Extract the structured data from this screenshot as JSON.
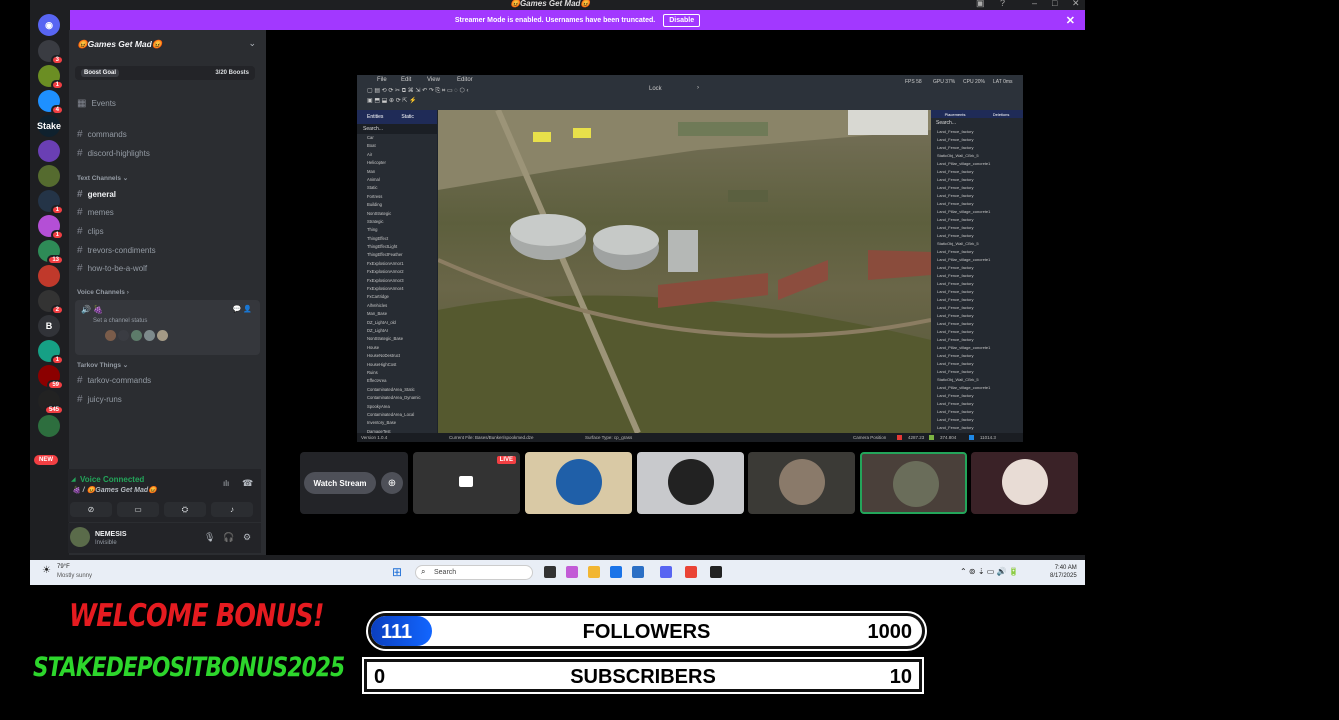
{
  "titlebar": {
    "title": "😡Games Get Mad😡"
  },
  "banner": {
    "text": "Streamer Mode is enabled. Usernames have been truncated.",
    "button": "Disable"
  },
  "servers": [
    {
      "label": "",
      "badge": "3",
      "color": "#3a3c42"
    },
    {
      "label": "",
      "badge": "1",
      "color": "#6b8e23"
    },
    {
      "label": "",
      "badge": "4",
      "color": "#1e90ff"
    },
    {
      "label": "Stake",
      "badge": "",
      "color": "#0f212e"
    },
    {
      "label": "",
      "badge": "",
      "color": "#6a3fb4"
    },
    {
      "label": "",
      "badge": "",
      "color": "#556b2f"
    },
    {
      "label": "",
      "badge": "1",
      "color": "#243447"
    },
    {
      "label": "",
      "badge": "1",
      "color": "#b44fd6"
    },
    {
      "label": "",
      "badge": "13",
      "color": "#2e8b57"
    },
    {
      "label": "",
      "badge": "",
      "color": "#c0392b"
    },
    {
      "label": "",
      "badge": "2",
      "color": "#333"
    },
    {
      "label": "B",
      "badge": "",
      "color": "#313338"
    },
    {
      "label": "",
      "badge": "1",
      "color": "#16a085"
    },
    {
      "label": "",
      "badge": "59",
      "color": "#8b0000"
    },
    {
      "label": "",
      "badge": "545",
      "color": "#222"
    },
    {
      "label": "",
      "badge": "",
      "color": "#2d6e3e"
    }
  ],
  "new_badge": "NEW",
  "sidebar": {
    "guild": "😡Games Get Mad😡",
    "boost_goal": "Boost Goal",
    "boosts": "3/20 Boosts",
    "events": "Events",
    "top_channels": [
      "commands",
      "discord-highlights"
    ],
    "text_category": "Text Channels",
    "text_channels": [
      "general",
      "memes",
      "clips",
      "trevors-condiments",
      "how-to-be-a-wolf"
    ],
    "voice_category": "Voice Channels",
    "voice_status": "Set a channel status",
    "tarkov_category": "Tarkov Things",
    "tarkov_channels": [
      "tarkov-commands",
      "juicy-runs"
    ]
  },
  "voice_panel": {
    "status": "Voice Connected",
    "channel": "🍇 / 😡Games Get Mad😡"
  },
  "user": {
    "name": "NEMESIS",
    "status": "Invisible"
  },
  "editor": {
    "menu": [
      "File",
      "Edit",
      "View",
      "Editor"
    ],
    "lock": "Lock",
    "stats": [
      "FPS 58",
      "GPU 37%",
      "CPU 20%",
      "LAT 0ms"
    ],
    "left_tabs": [
      "Entities",
      "Static"
    ],
    "left_search": "Search...",
    "left_items": [
      "Car",
      "Boat",
      "Air",
      "Helicopter",
      "Man",
      "Animal",
      "Static",
      "Fortress",
      "Building",
      "NonStrategic",
      "Strategic",
      "Thing",
      "ThingEffect",
      "ThingEffectLight",
      "ThingEffectFeather",
      "FxExplosionArmor1",
      "FxExplosionArmor2",
      "FxExplosionArmor3",
      "FxExplosionArmor4",
      "FxCartridge",
      "AllVehicles",
      "Man_Base",
      "DZ_LightAI_old",
      "DZ_LightAI",
      "NonStrategic_Base",
      "House",
      "HouseNoDestruct",
      "HouseHighCost",
      "Ruins",
      "EffectArea",
      "ContaminatedArea_Static",
      "ContaminatedArea_Dynamic",
      "SpookyArea",
      "ContaminatedArea_Local",
      "Inventory_Base",
      "DamageTest"
    ],
    "right_tabs": [
      "Placements",
      "Deletions"
    ],
    "right_search": "Search...",
    "right_items": [
      "Land_Fence_factory",
      "Land_Fence_factory",
      "Land_Fence_factory",
      "StaticObj_Wall_CBrk_5",
      "Land_Pillar_village_concrete1",
      "Land_Fence_factory",
      "Land_Fence_factory",
      "Land_Fence_factory",
      "Land_Fence_factory",
      "Land_Fence_factory",
      "Land_Pillar_village_concrete1",
      "Land_Fence_factory",
      "Land_Fence_factory",
      "Land_Fence_factory",
      "StaticObj_Wall_CBrk_5",
      "Land_Fence_factory",
      "Land_Pillar_village_concrete1",
      "Land_Fence_factory",
      "Land_Fence_factory",
      "Land_Fence_factory",
      "Land_Fence_factory",
      "Land_Fence_factory",
      "Land_Fence_factory",
      "Land_Fence_factory",
      "Land_Fence_factory",
      "Land_Fence_factory",
      "Land_Fence_factory",
      "Land_Pillar_village_concrete1",
      "Land_Fence_factory",
      "Land_Fence_factory",
      "Land_Fence_factory",
      "StaticObj_Wall_CBrk_5",
      "Land_Pillar_village_concrete1",
      "Land_Fence_factory",
      "Land_Fence_factory",
      "Land_Fence_factory",
      "Land_Fence_factory",
      "Land_Fence_factory",
      "Land_Fence_factory",
      "Land_Fence_factory"
    ],
    "status_left": "Version 1.0.4",
    "status_file": "Current File: Bases/Bunker/spookmed.dze",
    "status_surface": "Surface Type: cp_grass",
    "status_camera": "Camera Position",
    "coords": [
      "4287.23",
      "374.804",
      "11014.3"
    ]
  },
  "stream": {
    "watch": "Watch Stream",
    "live": "LIVE"
  },
  "avatars_colors": [
    "#d9c9a5",
    "#c8c9cc",
    "#3b3a36",
    "#4a403a",
    "#3a2227"
  ],
  "taskbar": {
    "temp": "79°F",
    "weather": "Mostly sunny",
    "search": "Search",
    "time": "7:40 AM",
    "date": "8/17/2025"
  },
  "overlay": {
    "welcome": "WELCOME BONUS!",
    "code": "STAKEDEPOSITBONUS2025",
    "followers": {
      "label": "FOLLOWERS",
      "current": "111",
      "goal": "1000",
      "progress": 0.111
    },
    "subscribers": {
      "label": "SUBSCRIBERS",
      "current": "0",
      "goal": "10",
      "progress": 0
    }
  }
}
